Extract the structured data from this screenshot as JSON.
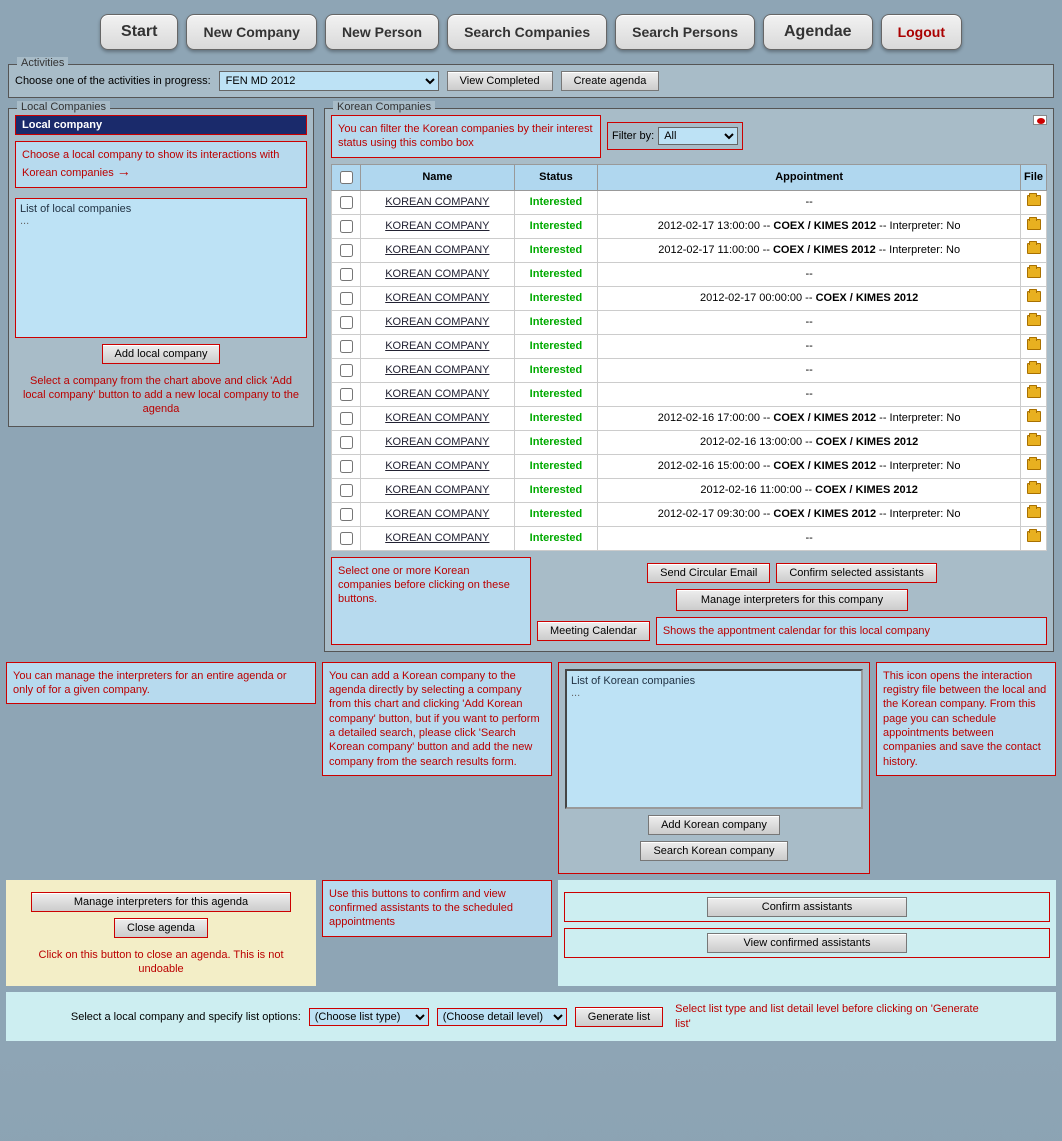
{
  "toolbar": {
    "start": "Start",
    "new_company": "New Company",
    "new_person": "New Person",
    "search_companies": "Search Companies",
    "search_persons": "Search Persons",
    "agendae": "Agendae",
    "logout": "Logout"
  },
  "activities": {
    "legend": "Activities",
    "prompt": "Choose one of the activities in progress:",
    "selected": "FEN   MD 2012",
    "view_completed": "View Completed",
    "create_agenda": "Create agenda"
  },
  "local": {
    "legend": "Local Companies",
    "selected": "Local company",
    "annot_choose": "Choose a local company to show its interactions with Korean companies",
    "list_header": "List of local companies",
    "list_dots": "...",
    "add_btn": "Add local company",
    "annot_add": "Select a company from the chart above and click 'Add local company' button to add a new local company to the agenda"
  },
  "korean": {
    "legend": "Korean Companies",
    "annot_filter": "You can filter the Korean companies by their interest status using this combo box",
    "filter_label": "Filter by:",
    "filter_value": "All",
    "headers": {
      "name": "Name",
      "status": "Status",
      "appointment": "Appointment",
      "file": "File"
    },
    "rows": [
      {
        "name": "KOREAN COMPANY",
        "status": "Interested",
        "appt": "--"
      },
      {
        "name": "KOREAN COMPANY",
        "status": "Interested",
        "appt": "2012-02-17 13:00:00 -- COEX / KIMES 2012 -- Interpreter: No"
      },
      {
        "name": "KOREAN COMPANY",
        "status": "Interested",
        "appt": "2012-02-17 11:00:00 -- COEX / KIMES 2012 -- Interpreter: No"
      },
      {
        "name": "KOREAN COMPANY",
        "status": "Interested",
        "appt": "--"
      },
      {
        "name": "KOREAN COMPANY",
        "status": "Interested",
        "appt": "2012-02-17 00:00:00 -- COEX / KIMES 2012"
      },
      {
        "name": "KOREAN COMPANY",
        "status": "Interested",
        "appt": "--"
      },
      {
        "name": "KOREAN COMPANY",
        "status": "Interested",
        "appt": "--"
      },
      {
        "name": "KOREAN COMPANY",
        "status": "Interested",
        "appt": "--"
      },
      {
        "name": "KOREAN COMPANY",
        "status": "Interested",
        "appt": "--"
      },
      {
        "name": "KOREAN COMPANY",
        "status": "Interested",
        "appt": "2012-02-16 17:00:00 -- COEX / KIMES 2012 -- Interpreter: No"
      },
      {
        "name": "KOREAN COMPANY",
        "status": "Interested",
        "appt": "2012-02-16 13:00:00 -- COEX / KIMES 2012"
      },
      {
        "name": "KOREAN COMPANY",
        "status": "Interested",
        "appt": "2012-02-16 15:00:00 -- COEX / KIMES 2012 -- Interpreter: No"
      },
      {
        "name": "KOREAN COMPANY",
        "status": "Interested",
        "appt": "2012-02-16 11:00:00 -- COEX / KIMES 2012"
      },
      {
        "name": "KOREAN COMPANY",
        "status": "Interested",
        "appt": "2012-02-17 09:30:00 -- COEX / KIMES 2012 -- Interpreter: No"
      },
      {
        "name": "KOREAN COMPANY",
        "status": "Interested",
        "appt": "--"
      }
    ],
    "send_circular": "Send Circular Email",
    "confirm_selected": "Confirm selected assistants",
    "annot_select": "Select one or more Korean companies before clicking on these buttons.",
    "manage_interp_company": "Manage interpreters for this company",
    "meeting_cal": "Meeting Calendar",
    "annot_cal": "Shows the appontment calendar for this local company"
  },
  "lower": {
    "annot_interp": "You can manage the interpreters for an entire agenda or only of for a given company.",
    "annot_add_korean": "You can add a Korean company to the agenda directly by selecting a company from this chart and clicking 'Add Korean company' button, but if you want to perform a detailed search, please click 'Search Korean company' button and add the new company from the search results form.",
    "korean_list_header": "List of Korean companies",
    "korean_list_dots": "...",
    "add_korean": "Add Korean company",
    "search_korean": "Search Korean company",
    "annot_file": "This icon opens the interaction registry file between the local and the Korean company. From this page you can schedule appointments between companies and save the contact history.",
    "manage_interp_agenda": "Manage interpreters for this agenda",
    "close_agenda": "Close agenda",
    "annot_close": "Click on this button to close an agenda. This is not undoable",
    "annot_confirm": "Use this buttons to confirm and view confirmed assistants to the scheduled appointments",
    "confirm_assist": "Confirm assistants",
    "view_confirmed": "View confirmed assistants"
  },
  "bottom": {
    "prompt": "Select a local company and specify list options:",
    "choose_type": "(Choose list type)",
    "choose_detail": "(Choose detail level)",
    "generate": "Generate list",
    "annot": "Select list type and list detail level before clicking on 'Generate list'"
  }
}
